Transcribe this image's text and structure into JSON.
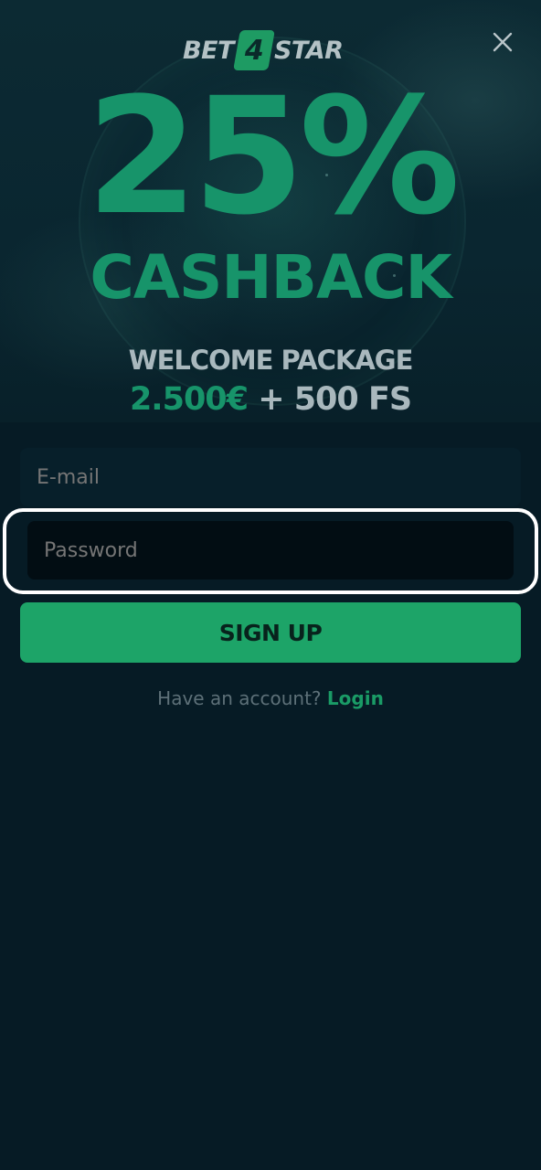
{
  "promo": {
    "logo_left": "BET",
    "logo_badge": "4",
    "logo_right": "STAR",
    "headline": "25%",
    "subheadline": "CASHBACK",
    "package_label": "WELCOME PACKAGE",
    "package_amount": "2.500€",
    "package_extra": "+ 500 FS"
  },
  "form": {
    "email_placeholder": "E-mail",
    "password_placeholder": "Password",
    "signup_label": "SIGN UP",
    "account_prompt": "Have an account?",
    "login_label": "Login"
  },
  "icons": {
    "close": "close-icon"
  },
  "colors": {
    "background": "#061b25",
    "brand_green": "#1da468",
    "headline_green": "#17946a",
    "muted_text": "#a9b8bd",
    "focus_ring": "#ffffff"
  }
}
